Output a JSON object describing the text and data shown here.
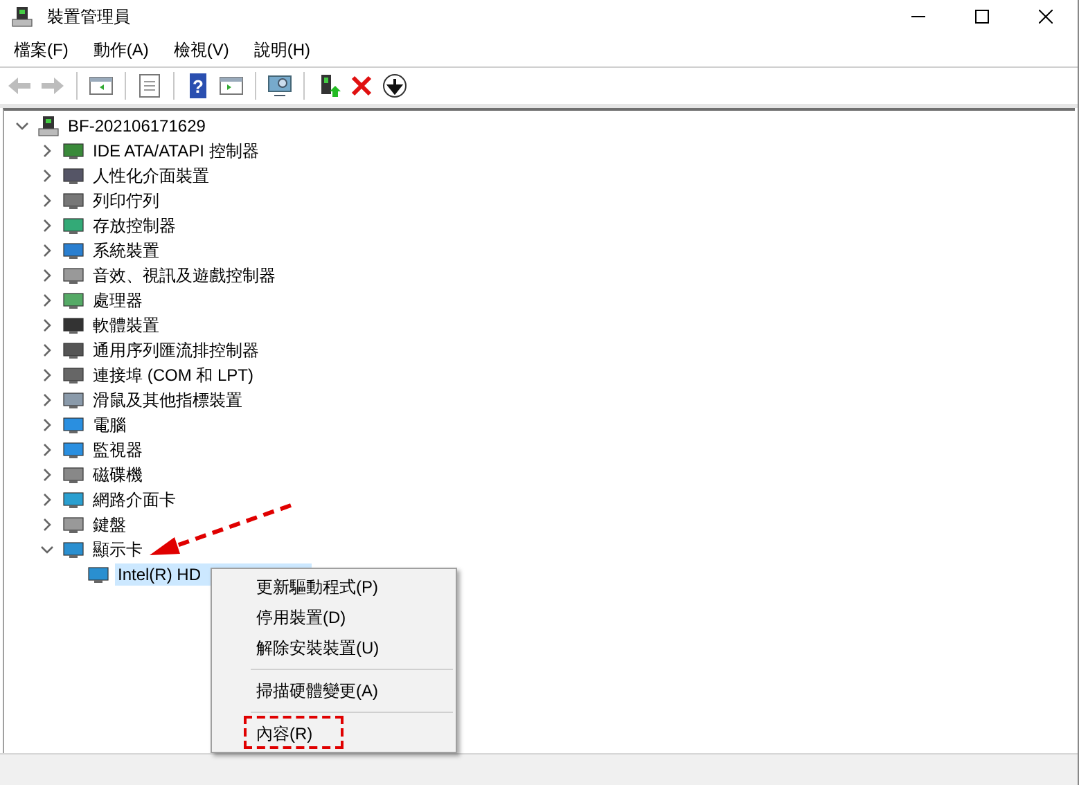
{
  "window": {
    "title": "裝置管理員"
  },
  "menu": [
    {
      "label": "檔案(F)"
    },
    {
      "label": "動作(A)"
    },
    {
      "label": "檢視(V)"
    },
    {
      "label": "說明(H)"
    }
  ],
  "toolbar": [
    {
      "kind": "back",
      "disabled": true
    },
    {
      "kind": "forward",
      "disabled": true
    },
    {
      "kind": "sep"
    },
    {
      "kind": "panel",
      "disabled": false
    },
    {
      "kind": "sep"
    },
    {
      "kind": "sheet",
      "disabled": false
    },
    {
      "kind": "sep"
    },
    {
      "kind": "help",
      "disabled": false,
      "glyph": "?"
    },
    {
      "kind": "panel2",
      "disabled": false
    },
    {
      "kind": "sep"
    },
    {
      "kind": "scan",
      "disabled": false
    },
    {
      "kind": "sep"
    },
    {
      "kind": "adddriver",
      "disabled": false
    },
    {
      "kind": "remove",
      "disabled": false
    },
    {
      "kind": "down",
      "disabled": false
    }
  ],
  "tree": {
    "label": "BF-202106171629",
    "expanded": true,
    "children": [
      {
        "label": "IDE ATA/ATAPI 控制器",
        "expanded": false
      },
      {
        "label": "人性化介面裝置",
        "expanded": false
      },
      {
        "label": "列印佇列",
        "expanded": false
      },
      {
        "label": "存放控制器",
        "expanded": false
      },
      {
        "label": "系統裝置",
        "expanded": false
      },
      {
        "label": "音效、視訊及遊戲控制器",
        "expanded": false
      },
      {
        "label": "處理器",
        "expanded": false
      },
      {
        "label": "軟體裝置",
        "expanded": false
      },
      {
        "label": "通用序列匯流排控制器",
        "expanded": false
      },
      {
        "label": "連接埠 (COM 和 LPT)",
        "expanded": false
      },
      {
        "label": "滑鼠及其他指標裝置",
        "expanded": false
      },
      {
        "label": "電腦",
        "expanded": false
      },
      {
        "label": "監視器",
        "expanded": false
      },
      {
        "label": "磁碟機",
        "expanded": false
      },
      {
        "label": "網路介面卡",
        "expanded": false
      },
      {
        "label": "鍵盤",
        "expanded": false
      },
      {
        "label": "顯示卡",
        "expanded": true,
        "children": [
          {
            "label": "Intel(R) HD",
            "selected": true
          }
        ]
      }
    ]
  },
  "context_menu": [
    {
      "kind": "item",
      "label": "更新驅動程式(P)",
      "highlighted": false
    },
    {
      "kind": "item",
      "label": "停用裝置(D)",
      "highlighted": false
    },
    {
      "kind": "item",
      "label": "解除安裝裝置(U)",
      "highlighted": false
    },
    {
      "kind": "separator"
    },
    {
      "kind": "item",
      "label": "掃描硬體變更(A)",
      "highlighted": false
    },
    {
      "kind": "separator"
    },
    {
      "kind": "item",
      "label": "內容(R)",
      "highlighted": true
    }
  ]
}
